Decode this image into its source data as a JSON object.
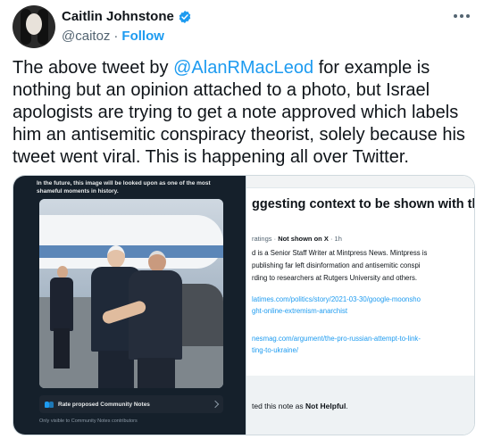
{
  "author": {
    "display_name": "Caitlin Johnstone",
    "handle": "@caitoz",
    "separator": "·",
    "follow_label": "Follow",
    "verified_color": "#1d9bf0"
  },
  "tweet": {
    "text_before": "The above tweet by ",
    "mention": "@AlanRMacLeod",
    "text_after": " for example is nothing but an opinion attached to a photo, but Israel apologists are trying to get a note approved which labels him an antisemitic conspiracy theorist, solely because his tweet went viral. This is happening all over Twitter."
  },
  "left_screenshot": {
    "caption": "In the future, this image will be looked upon as one of the most shameful moments in history.",
    "rate_label": "Rate proposed Community Notes",
    "visibility": "Only visible to Community Notes contributors"
  },
  "right_screenshot": {
    "heading": "ggesting context to be shown with the p",
    "meta_prefix": "ratings · ",
    "meta_status": "Not shown on X",
    "meta_suffix": " · 1h",
    "body_lines": [
      "d is a Senior Staff Writer at Mintpress News.  Mintpress is",
      " publishing far left disinformation and antisemitic  conspi",
      "rding to researchers at Rutgers University and others."
    ],
    "link_lines_1": [
      "latimes.com/politics/story/2021-03-30/google-moonsho",
      "ght-online-extremism-anarchist"
    ],
    "link_lines_2": [
      "nesmag.com/argument/the-pro-russian-attempt-to-link-",
      "ting-to-ukraine/"
    ],
    "card_prefix": "ted this note as ",
    "card_rating": "Not Helpful",
    "card_suffix": "."
  }
}
